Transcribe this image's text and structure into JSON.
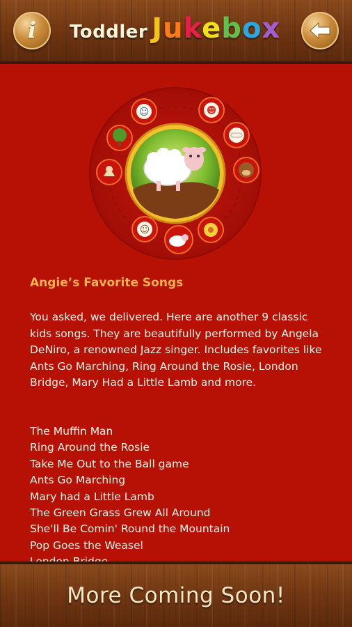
{
  "header": {
    "title_part1": "Toddler",
    "title_part2_letters": [
      "J",
      "u",
      "k",
      "e",
      "b",
      "o",
      "x"
    ],
    "info_label": "i",
    "info_icon": "info-icon",
    "back_icon": "back-arrow-icon"
  },
  "wheel": {
    "center_icon": "sheep-icon",
    "items": [
      "farmer-icon",
      "girl-icon",
      "bone-icon",
      "monkey-icon",
      "flower-icon",
      "sheep-icon",
      "boy-icon",
      "cat-icon",
      "tree-icon"
    ]
  },
  "album": {
    "title": "Angie’s Favorite Songs",
    "description": "You asked, we delivered. Here are another 9 classic kids songs. They are beautifully performed by Angela DeNiro, a renowned Jazz singer. Includes favorites like Ants Go Marching, Ring Around the Rosie, London Bridge, Mary Had a Little Lamb and more.",
    "songs": [
      "The Muffin Man",
      "Ring Around the Rosie",
      "Take Me Out to the Ball game",
      "Ants Go Marching",
      "Mary had a Little Lamb",
      "The Green Grass Grew All Around",
      "She'll Be Comin' Round the Mountain",
      "Pop Goes the Weasel",
      "London Bridge"
    ]
  },
  "footer": {
    "label": "More Coming Soon!"
  },
  "colors": {
    "background": "#b71106",
    "heading": "#f9b24c",
    "text": "#fdf6ea"
  }
}
